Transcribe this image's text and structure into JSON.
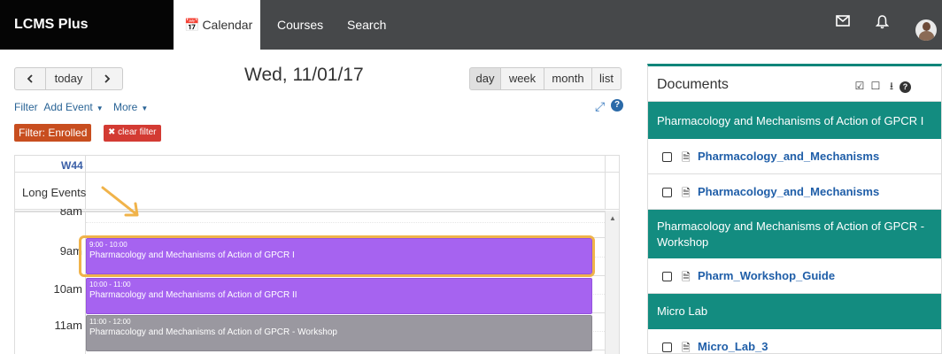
{
  "navbar": {
    "brand": "LCMS Plus",
    "tabs": [
      {
        "label": "Calendar",
        "icon": "calendar-icon",
        "active": true
      },
      {
        "label": "Courses",
        "active": false
      },
      {
        "label": "Search",
        "active": false
      }
    ],
    "icons": [
      "mail-icon",
      "bell-icon",
      "avatar"
    ]
  },
  "toolbar": {
    "prev": "<",
    "today": "today",
    "next": ">",
    "date_title": "Wed, 11/01/17",
    "views": [
      "day",
      "week",
      "month",
      "list"
    ],
    "active_view": "day"
  },
  "links": {
    "filter": "Filter",
    "add_event": "Add Event",
    "more": "More",
    "filter_badge": "Filter: Enrolled",
    "clear_filter": "clear filter"
  },
  "calendar": {
    "week": "W44",
    "long_events": "Long Events",
    "times": [
      "8am",
      "9am",
      "10am",
      "11am"
    ],
    "events": [
      {
        "time": "9:00 - 10:00",
        "title": "Pharmacology and Mechanisms of Action of GPCR I",
        "color": "#a663f0"
      },
      {
        "time": "10:00 - 11:00",
        "title": "Pharmacology and Mechanisms of Action of GPCR II",
        "color": "#a663f0"
      },
      {
        "time": "11:00 - 12:00",
        "title": "Pharmacology and Mechanisms of Action of GPCR - Workshop",
        "color": "#9a98a0"
      }
    ]
  },
  "documents": {
    "title": "Documents",
    "sections": [
      {
        "title": "Pharmacology and Mechanisms of Action of GPCR I",
        "items": [
          {
            "name": "Pharmacology_and_Mechanisms",
            "type": "pdf-file-icon"
          },
          {
            "name": "Pharmacology_and_Mechanisms",
            "type": "pdf-doc-icon"
          }
        ]
      },
      {
        "title": "Pharmacology and Mechanisms of Action of GPCR - Workshop",
        "items": [
          {
            "name": "Pharm_Workshop_Guide",
            "type": "word-file-icon"
          }
        ]
      },
      {
        "title": "Micro Lab",
        "items": [
          {
            "name": "Micro_Lab_3",
            "type": "pdf-file-icon"
          }
        ]
      }
    ]
  },
  "colors": {
    "accent": "#138c80",
    "filter_badge": "#c84e1f",
    "clear_badge": "#d33b33",
    "highlight": "#f0b34a"
  }
}
